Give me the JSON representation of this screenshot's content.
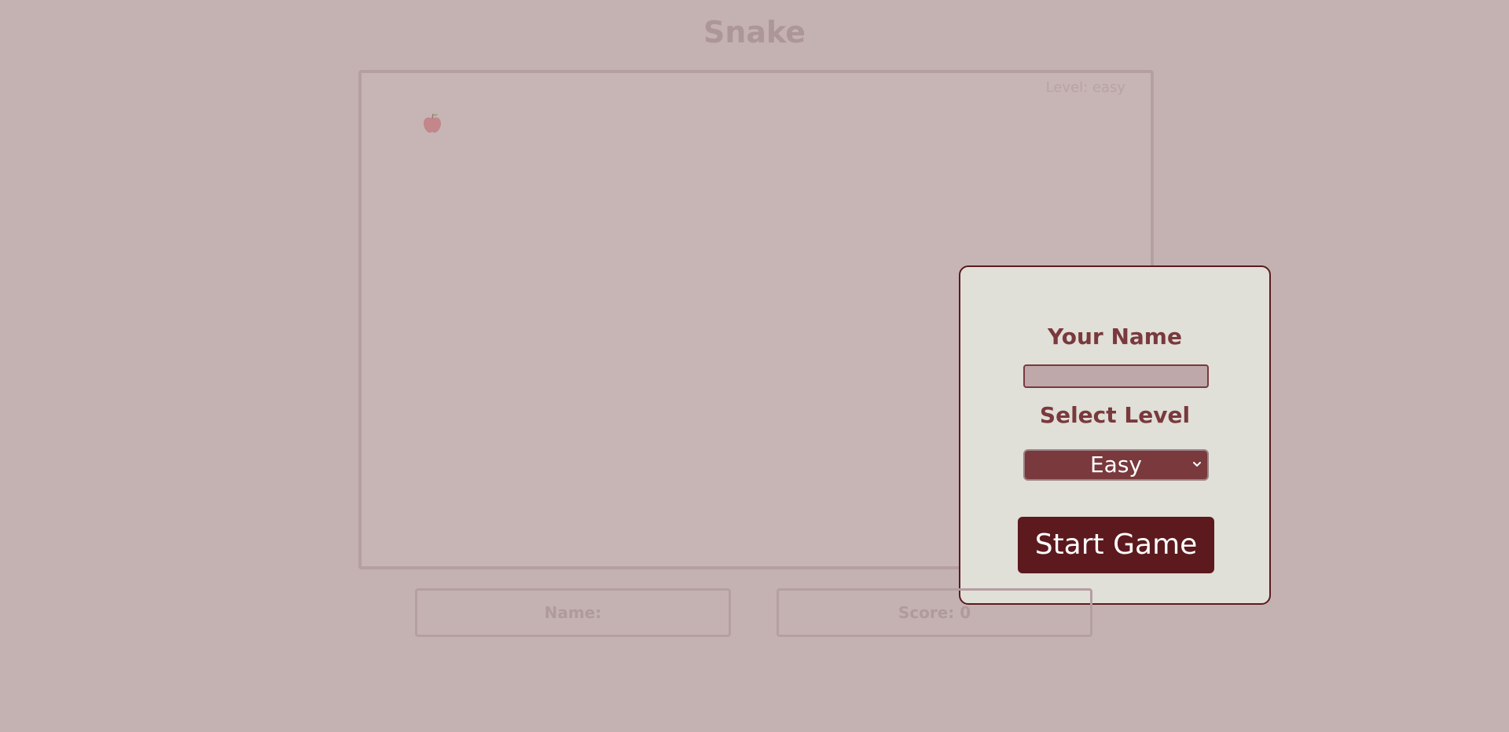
{
  "title": "Snake",
  "board": {
    "level_text": "Level: easy",
    "food_icon": "apple-icon"
  },
  "modal": {
    "name_label": "Your Name",
    "name_value": "",
    "name_placeholder": "",
    "level_label": "Select Level",
    "level_selected": "Easy",
    "start_label": "Start Game"
  },
  "footer": {
    "name_text": "Name:",
    "score_text": "Score: 0"
  },
  "colors": {
    "background": "#c4b2b2",
    "modal_bg": "#e0dfd8",
    "accent_dark": "#5c1a1e",
    "accent": "#79393d",
    "apple": "#c0606a"
  }
}
